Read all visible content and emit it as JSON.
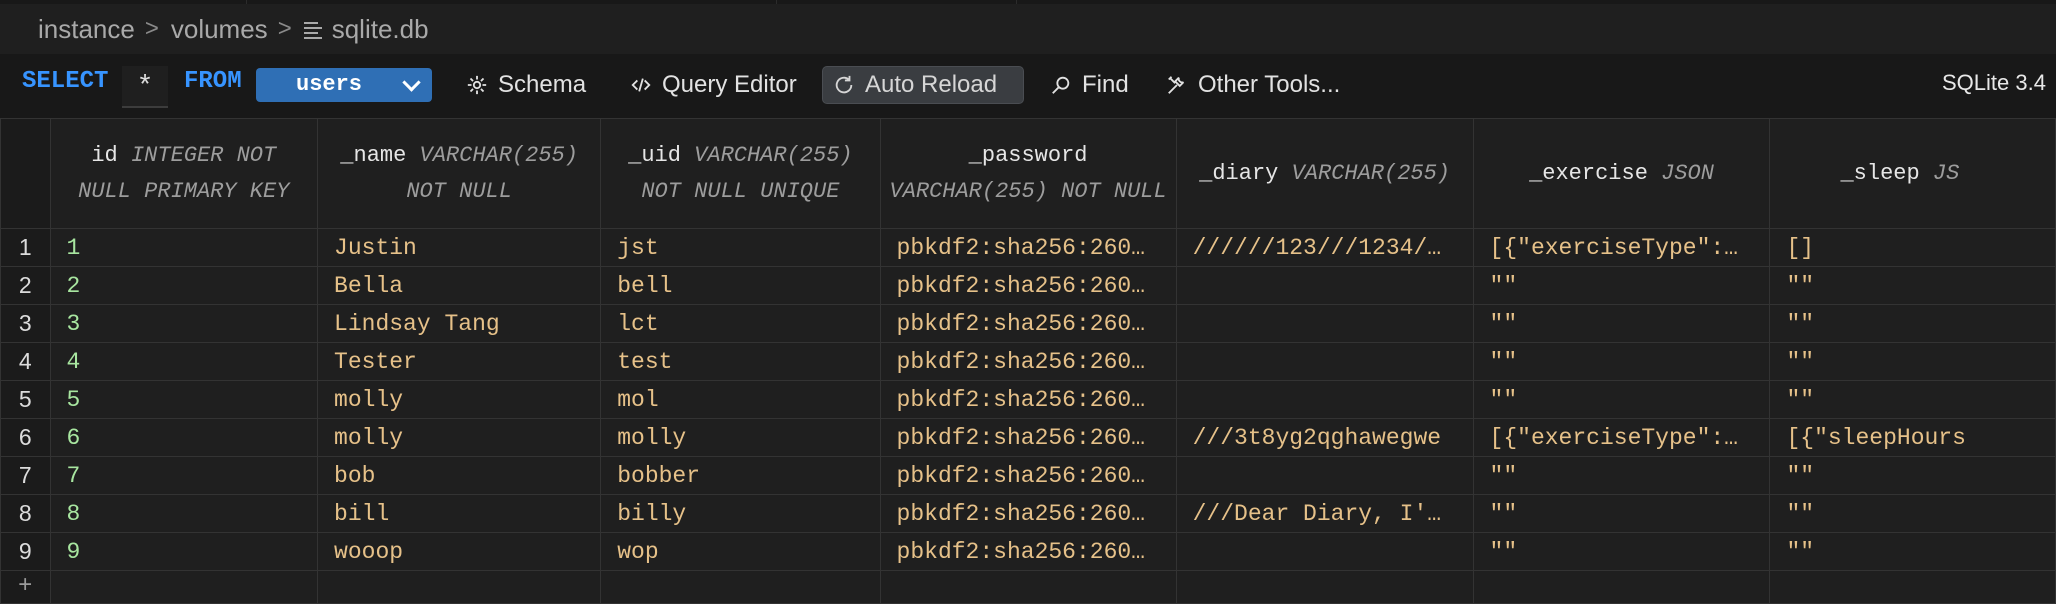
{
  "breadcrumb": {
    "items": [
      "instance",
      "volumes",
      "sqlite.db"
    ]
  },
  "toolbar": {
    "select_kw": "SELECT",
    "columns_value": "*",
    "from_kw": "FROM",
    "table_value": "users",
    "schema_label": "Schema",
    "query_editor_label": "Query Editor",
    "auto_reload_label": "Auto Reload",
    "find_label": "Find",
    "other_tools_label": "Other Tools...",
    "version_label": "SQLite 3.4"
  },
  "colors": {
    "keyword": "#3794ff",
    "table_select_bg": "#2f6fb5",
    "cell_text": "#e6c189",
    "id_text": "#a8e6a0"
  },
  "columns": [
    {
      "name": "id",
      "type": "INTEGER NOT NULL PRIMARY KEY"
    },
    {
      "name": "_name",
      "type": "VARCHAR(255) NOT NULL"
    },
    {
      "name": "_uid",
      "type": "VARCHAR(255) NOT NULL UNIQUE"
    },
    {
      "name": "_password",
      "type": "VARCHAR(255) NOT NULL"
    },
    {
      "name": "_diary",
      "type": "VARCHAR(255)"
    },
    {
      "name": "_exercise",
      "type": "JSON"
    },
    {
      "name": "_sleep",
      "type": "JS"
    }
  ],
  "rows": [
    {
      "n": "1",
      "cells": [
        "1",
        "Justin",
        "jst",
        "pbkdf2:sha256:260…",
        "//////123///1234/…",
        "[{\"exerciseType\":…",
        "[]"
      ]
    },
    {
      "n": "2",
      "cells": [
        "2",
        "Bella",
        "bell",
        "pbkdf2:sha256:260…",
        "",
        "\"\"",
        "\"\""
      ]
    },
    {
      "n": "3",
      "cells": [
        "3",
        "Lindsay Tang",
        "lct",
        "pbkdf2:sha256:260…",
        "",
        "\"\"",
        "\"\""
      ]
    },
    {
      "n": "4",
      "cells": [
        "4",
        "Tester",
        "test",
        "pbkdf2:sha256:260…",
        "",
        "\"\"",
        "\"\""
      ]
    },
    {
      "n": "5",
      "cells": [
        "5",
        "molly",
        "mol",
        "pbkdf2:sha256:260…",
        "",
        "\"\"",
        "\"\""
      ]
    },
    {
      "n": "6",
      "cells": [
        "6",
        "molly",
        "molly",
        "pbkdf2:sha256:260…",
        "///3t8yg2qghawegwe",
        "[{\"exerciseType\":…",
        "[{\"sleepHours"
      ]
    },
    {
      "n": "7",
      "cells": [
        "7",
        "bob",
        "bobber",
        "pbkdf2:sha256:260…",
        "",
        "\"\"",
        "\"\""
      ]
    },
    {
      "n": "8",
      "cells": [
        "8",
        "bill",
        "billy",
        "pbkdf2:sha256:260…",
        "///Dear Diary, I'…",
        "\"\"",
        "\"\""
      ]
    },
    {
      "n": "9",
      "cells": [
        "9",
        "wooop",
        "wop",
        "pbkdf2:sha256:260…",
        "",
        "\"\"",
        "\"\""
      ]
    }
  ],
  "add_row_label": "+"
}
